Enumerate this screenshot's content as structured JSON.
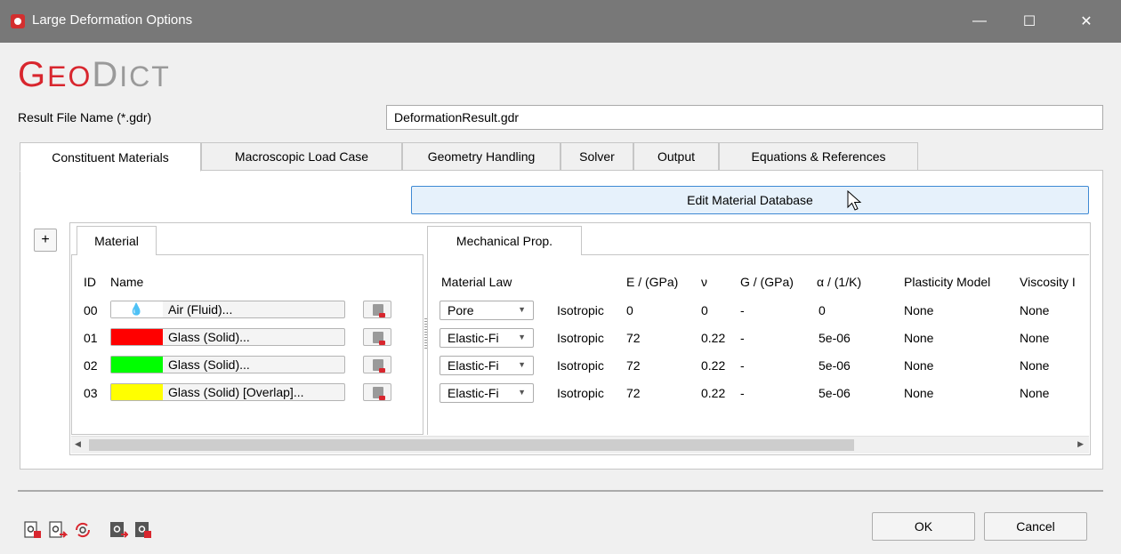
{
  "window": {
    "title": "Large Deformation Options",
    "minimize": "—",
    "maximize": "☐",
    "close": "✕"
  },
  "logo": {
    "part1": "G",
    "part2": "EO",
    "part3": "D",
    "part4": "ICT"
  },
  "result_file": {
    "label": "Result File Name (*.gdr)",
    "value": "DeformationResult.gdr"
  },
  "tabs": [
    {
      "label": "Constituent Materials",
      "active": true
    },
    {
      "label": "Macroscopic Load Case",
      "active": false
    },
    {
      "label": "Geometry Handling",
      "active": false
    },
    {
      "label": "Solver",
      "active": false
    },
    {
      "label": "Output",
      "active": false
    },
    {
      "label": "Equations & References",
      "active": false
    }
  ],
  "edit_db_label": "Edit Material Database",
  "plus_label": "+",
  "material_panel": {
    "tab_label": "Material",
    "headers": {
      "id": "ID",
      "name": "Name"
    }
  },
  "mech_panel": {
    "tab_label": "Mechanical Prop.",
    "headers": {
      "law": "Material Law",
      "e": "E / (GPa)",
      "nu": "ν",
      "g": "G / (GPa)",
      "alpha": "α / (1/K)",
      "plasticity": "Plasticity Model",
      "viscosity": "Viscosity I"
    }
  },
  "materials": [
    {
      "id": "00",
      "name": "Air (Fluid)...",
      "color": "#ffffff",
      "fluid": true,
      "law": "Pore",
      "symmetry": "Isotropic",
      "e": "0",
      "nu": "0",
      "g": "-",
      "alpha": "0",
      "plasticity": "None",
      "viscosity": "None"
    },
    {
      "id": "01",
      "name": "Glass (Solid)...",
      "color": "#ff0000",
      "fluid": false,
      "law": "Elastic-Fi",
      "symmetry": "Isotropic",
      "e": "72",
      "nu": "0.22",
      "g": "-",
      "alpha": "5e-06",
      "plasticity": "None",
      "viscosity": "None"
    },
    {
      "id": "02",
      "name": "Glass (Solid)...",
      "color": "#00ff00",
      "fluid": false,
      "law": "Elastic-Fi",
      "symmetry": "Isotropic",
      "e": "72",
      "nu": "0.22",
      "g": "-",
      "alpha": "5e-06",
      "plasticity": "None",
      "viscosity": "None"
    },
    {
      "id": "03",
      "name": "Glass (Solid) [Overlap]...",
      "color": "#ffff00",
      "fluid": false,
      "law": "Elastic-Fi",
      "symmetry": "Isotropic",
      "e": "72",
      "nu": "0.22",
      "g": "-",
      "alpha": "5e-06",
      "plasticity": "None",
      "viscosity": "None"
    }
  ],
  "scroll": {
    "left": "◀",
    "right": "▶"
  },
  "combo_arrow": "▼",
  "bottom_icons": [
    "load-settings-icon",
    "save-settings-icon",
    "reset-settings-icon",
    "save-macro-icon",
    "load-macro-icon"
  ],
  "buttons": {
    "ok": "OK",
    "cancel": "Cancel"
  },
  "colors": {
    "brand_red": "#d8262e",
    "titlebar": "#787878",
    "focus_blue": "#3f8ad4"
  }
}
